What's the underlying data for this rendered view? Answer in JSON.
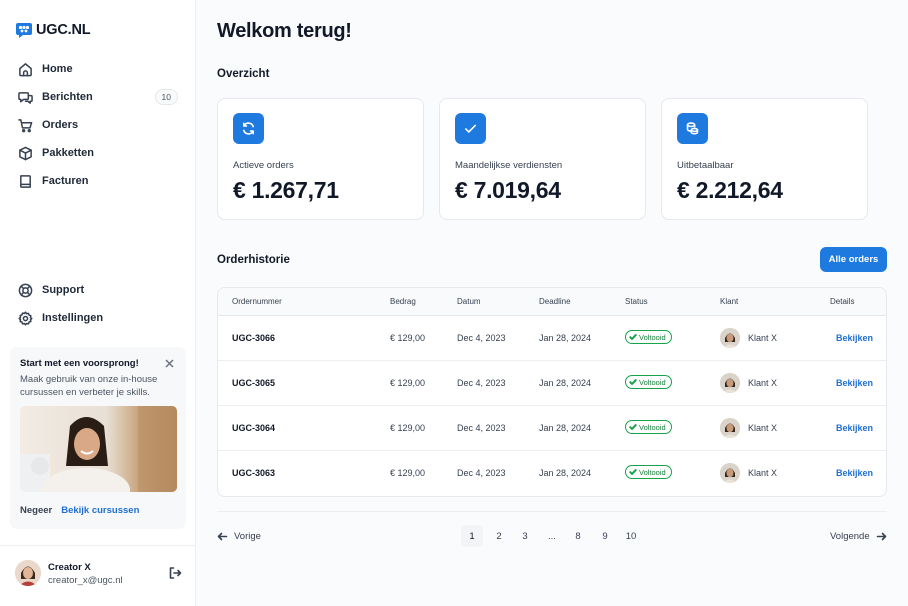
{
  "brand": {
    "name": "UGC.NL",
    "accent": "#1f7ae0"
  },
  "sidebar": {
    "items": [
      {
        "label": "Home",
        "icon": "home-icon"
      },
      {
        "label": "Berichten",
        "icon": "chat-icon",
        "badge": "10"
      },
      {
        "label": "Orders",
        "icon": "cart-icon"
      },
      {
        "label": "Pakketten",
        "icon": "package-icon"
      },
      {
        "label": "Facturen",
        "icon": "book-icon"
      }
    ],
    "bottom_items": [
      {
        "label": "Support",
        "icon": "lifebuoy-icon"
      },
      {
        "label": "Instellingen",
        "icon": "gear-icon"
      }
    ]
  },
  "promo": {
    "title": "Start met een voorsprong!",
    "text": "Maak gebruik van onze in-house cursussen en verbeter je skills.",
    "dismiss": "Negeer",
    "link": "Bekijk cursussen"
  },
  "user": {
    "name": "Creator X",
    "email": "creator_x@ugc.nl"
  },
  "main": {
    "title": "Welkom terug!",
    "overview_title": "Overzicht",
    "cards": [
      {
        "label": "Actieve orders",
        "value": "€ 1.267,71",
        "icon": "refresh-icon"
      },
      {
        "label": "Maandelijkse verdiensten",
        "value": "€ 7.019,64",
        "icon": "check-icon"
      },
      {
        "label": "Uitbetaalbaar",
        "value": "€ 2.212,64",
        "icon": "coins-icon"
      }
    ],
    "history_title": "Orderhistorie",
    "all_orders": "Alle orders"
  },
  "table": {
    "columns": [
      "Ordernummer",
      "Bedrag",
      "Datum",
      "Deadline",
      "Status",
      "Klant",
      "Details"
    ],
    "rows": [
      {
        "order": "UGC-3066",
        "amount": "€ 129,00",
        "date": "Dec 4, 2023",
        "deadline": "Jan 28, 2024",
        "status": "Voltooid",
        "client": "Klant X",
        "details": "Bekijken"
      },
      {
        "order": "UGC-3065",
        "amount": "€ 129,00",
        "date": "Dec 4, 2023",
        "deadline": "Jan 28, 2024",
        "status": "Voltooid",
        "client": "Klant X",
        "details": "Bekijken"
      },
      {
        "order": "UGC-3064",
        "amount": "€ 129,00",
        "date": "Dec 4, 2023",
        "deadline": "Jan 28, 2024",
        "status": "Voltooid",
        "client": "Klant X",
        "details": "Bekijken"
      },
      {
        "order": "UGC-3063",
        "amount": "€ 129,00",
        "date": "Dec 4, 2023",
        "deadline": "Jan 28, 2024",
        "status": "Voltooid",
        "client": "Klant X",
        "details": "Bekijken"
      }
    ]
  },
  "pagination": {
    "prev": "Vorige",
    "next": "Volgende",
    "pages": [
      "1",
      "2",
      "3",
      "...",
      "8",
      "9",
      "10"
    ],
    "current": "1"
  }
}
